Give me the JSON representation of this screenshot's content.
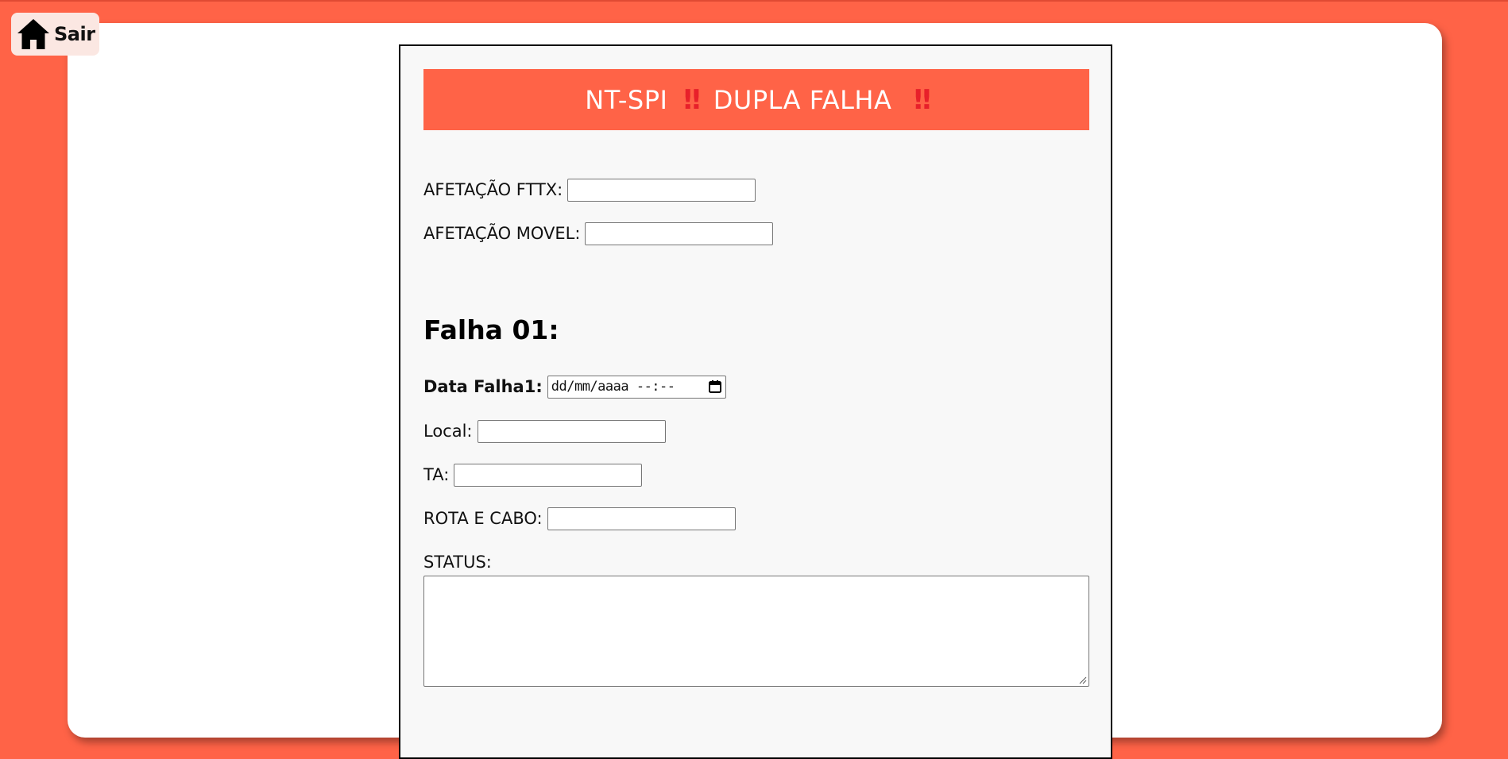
{
  "nav": {
    "exit_label": "Sair",
    "exit_icon": "home-icon"
  },
  "colors": {
    "page_background": "#ff6347",
    "banner_background": "#ff6347",
    "banner_text": "#ffffff",
    "alert_icon": "#e8202a"
  },
  "form": {
    "banner": {
      "title_part1": "NT-SPI",
      "title_part2": "DUPLA FALHA",
      "alert_glyph": "‼",
      "alert_icon": "double-exclamation-icon"
    },
    "afetacao_fttx": {
      "label": "AFETAÇÃO FTTX:",
      "value": ""
    },
    "afetacao_movel": {
      "label": "AFETAÇÃO MOVEL:",
      "value": ""
    },
    "falha01": {
      "title": "Falha 01:",
      "data_falha": {
        "label": "Data Falha1:",
        "placeholder": "dd/mm/aaaa --:--",
        "value": ""
      },
      "local": {
        "label": "Local:",
        "value": ""
      },
      "ta": {
        "label": "TA:",
        "value": ""
      },
      "rota_cabo": {
        "label": "ROTA E CABO:",
        "value": ""
      },
      "status": {
        "label": "STATUS:",
        "value": ""
      }
    }
  }
}
